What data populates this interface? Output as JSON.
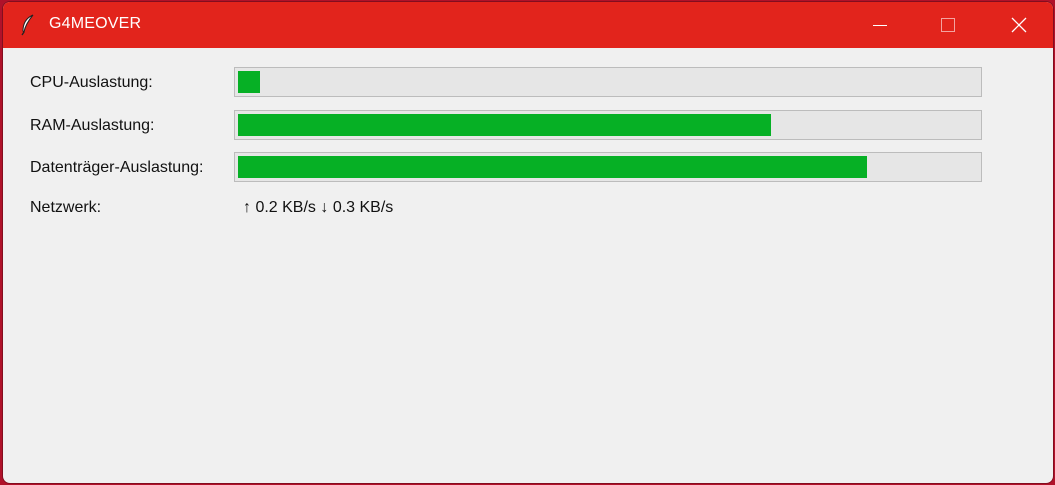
{
  "window": {
    "title": "G4MEOVER",
    "app_icon": "feather-icon",
    "controls": {
      "minimize_icon": "minimize-icon",
      "maximize_icon": "maximize-icon",
      "close_icon": "close-icon"
    },
    "accent_color": "#e2241c"
  },
  "metrics": [
    {
      "label": "CPU-Auslastung:",
      "percent": 3
    },
    {
      "label": "RAM-Auslastung:",
      "percent": 72
    },
    {
      "label": "Datenträger-Auslastung:",
      "percent": 85
    }
  ],
  "network": {
    "label": "Netzwerk:",
    "value": "↑ 0.2 KB/s  ↓ 0.3 KB/s"
  },
  "colors": {
    "bar_fill": "#06b025",
    "bar_track": "#e6e6e6"
  }
}
